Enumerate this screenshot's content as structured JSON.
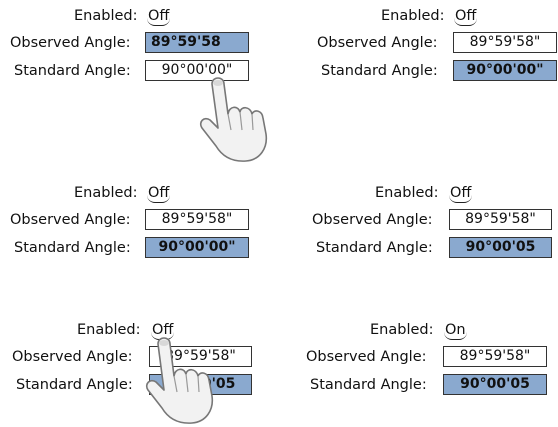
{
  "labels": {
    "enabled": "Enabled:",
    "observed": "Observed Angle:",
    "standard": "Standard Angle:"
  },
  "panels": [
    {
      "enabled": "Off",
      "observed": "89°59'58",
      "standard": "90°00'00\"",
      "selected": "observed"
    },
    {
      "enabled": "Off",
      "observed": "89°59'58\"",
      "standard": "90°00'00\"",
      "selected": "standard"
    },
    {
      "enabled": "Off",
      "observed": "89°59'58\"",
      "standard": "90°00'00\"",
      "selected": "standard"
    },
    {
      "enabled": "Off",
      "observed": "89°59'58\"",
      "standard": "90°00'05",
      "selected": "standard"
    },
    {
      "enabled": "Off",
      "observed": "89°59'58\"",
      "standard": "90°00'05",
      "selected": "standard"
    },
    {
      "enabled": "On",
      "observed": "89°59'58\"",
      "standard": "90°00'05",
      "selected": "standard"
    }
  ],
  "colors": {
    "selected_field": "#8aa9cf",
    "border": "#333333"
  },
  "icons": [
    "pointing-hand-icon"
  ]
}
